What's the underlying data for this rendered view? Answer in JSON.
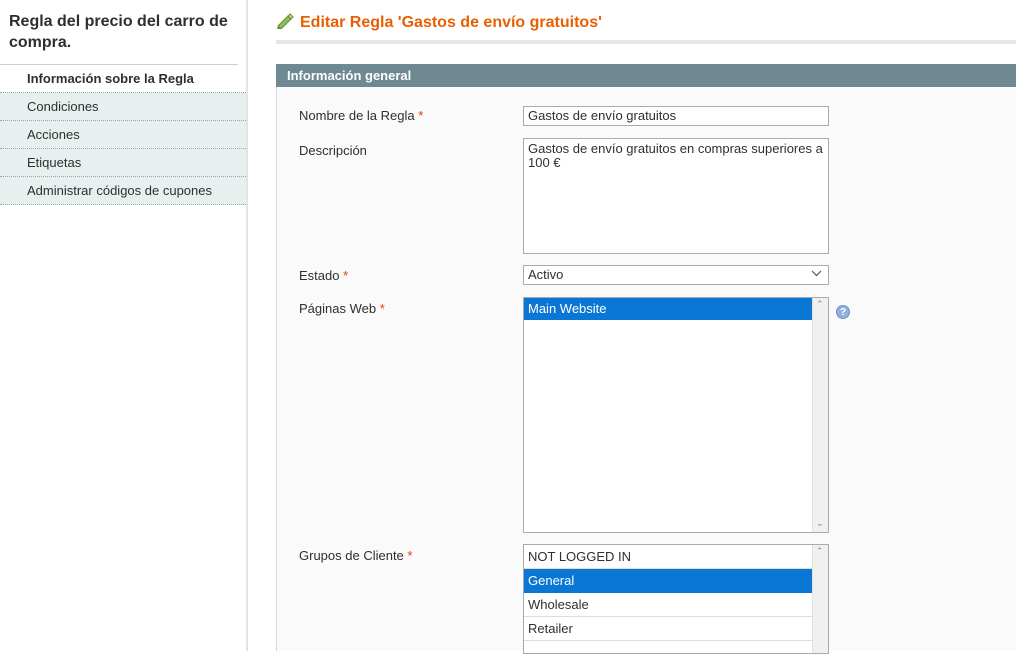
{
  "sidebar": {
    "title": "Regla del precio del carro de compra.",
    "tabs": [
      {
        "label": "Información sobre la Regla",
        "active": true
      },
      {
        "label": "Condiciones",
        "active": false
      },
      {
        "label": "Acciones",
        "active": false
      },
      {
        "label": "Etiquetas",
        "active": false
      },
      {
        "label": "Administrar códigos de cupones",
        "active": false
      }
    ]
  },
  "page": {
    "heading": "Editar Regla 'Gastos de envío gratuitos'",
    "heading_icon": "edit-pencil-icon",
    "accent_color": "#eb5e00"
  },
  "section": {
    "title": "Información general",
    "header_color": "#6f8992"
  },
  "form": {
    "rule_name": {
      "label": "Nombre de la Regla",
      "required": "*",
      "value": "Gastos de envío gratuitos"
    },
    "description": {
      "label": "Descripción",
      "value": "Gastos de envío gratuitos en compras superiores a 100 €"
    },
    "status": {
      "label": "Estado",
      "required": "*",
      "value": "Activo"
    },
    "websites": {
      "label": "Páginas Web",
      "required": "*",
      "options": [
        {
          "label": "Main Website",
          "selected": true
        }
      ]
    },
    "customer_groups": {
      "label": "Grupos de Cliente",
      "required": "*",
      "options": [
        {
          "label": "NOT LOGGED IN",
          "selected": false
        },
        {
          "label": "General",
          "selected": true
        },
        {
          "label": "Wholesale",
          "selected": false
        },
        {
          "label": "Retailer",
          "selected": false
        }
      ]
    }
  }
}
